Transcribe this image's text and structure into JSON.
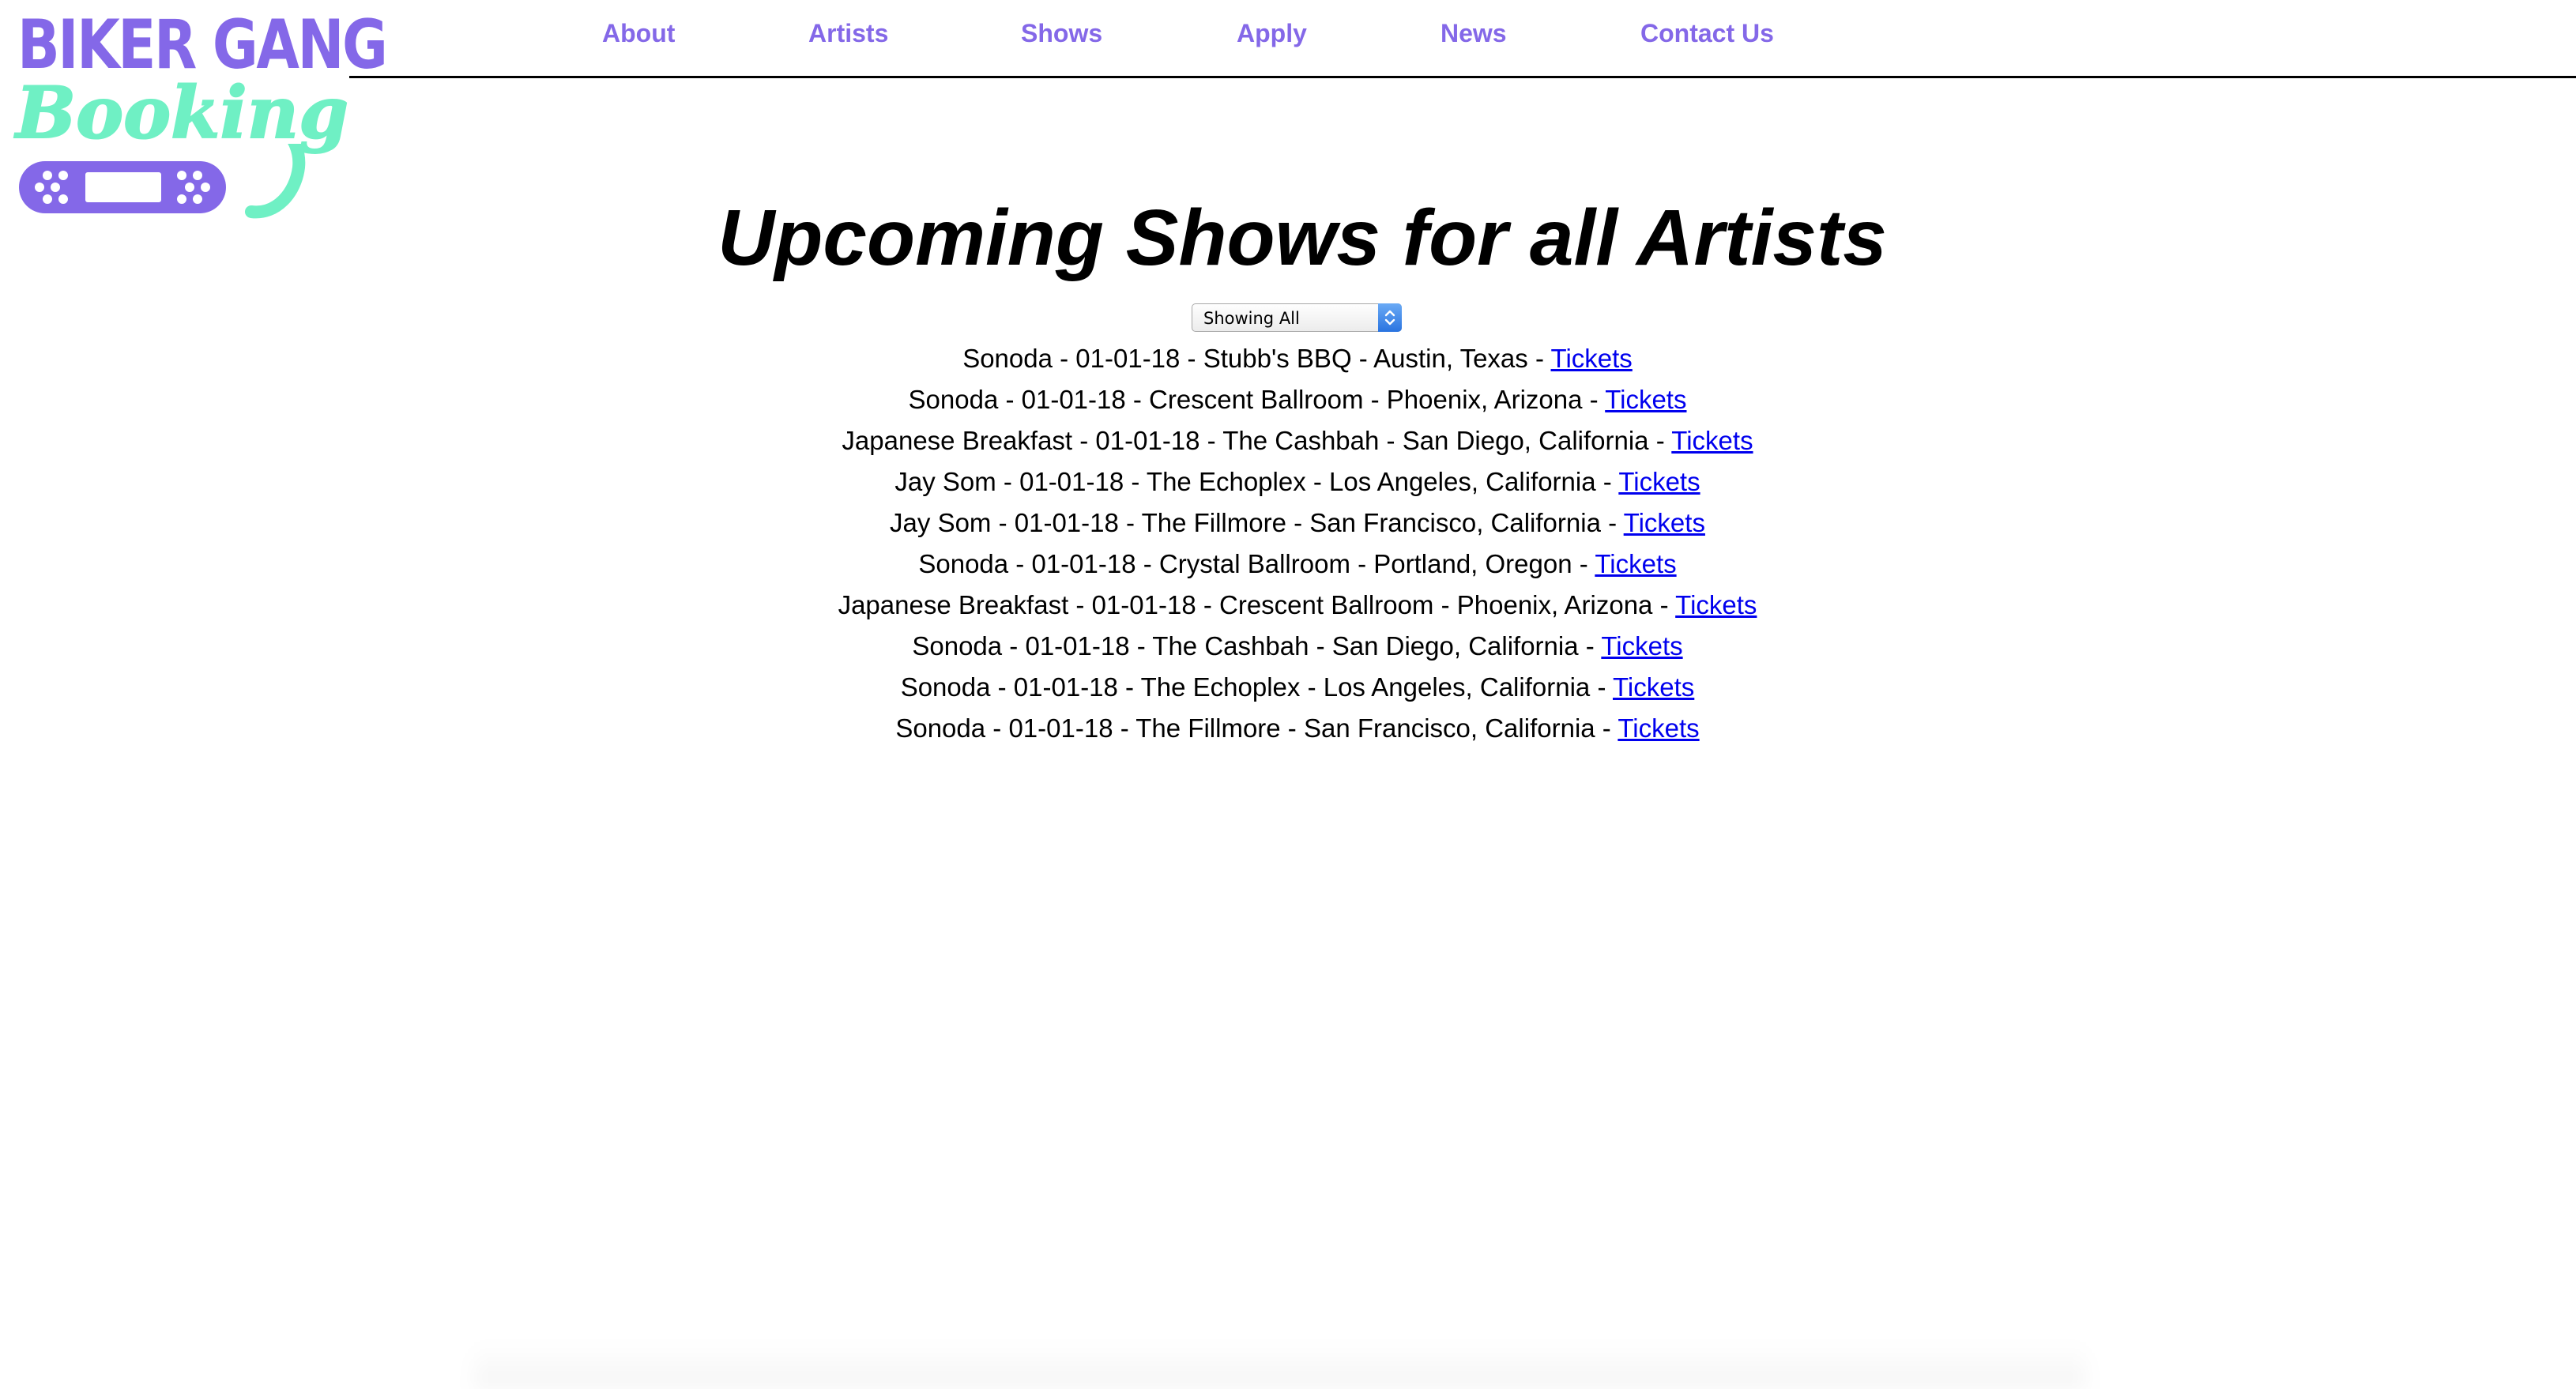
{
  "logo": {
    "line1": "BIKER GANG",
    "line2": "Booking",
    "colors": {
      "purple": "#8468e8",
      "mint": "#6ff0c4"
    }
  },
  "nav": {
    "items": [
      {
        "label": "About"
      },
      {
        "label": "Artists"
      },
      {
        "label": "Shows"
      },
      {
        "label": "Apply"
      },
      {
        "label": "News"
      },
      {
        "label": "Contact Us"
      }
    ],
    "color": "#8468e8"
  },
  "main": {
    "heading": "Upcoming Shows for all Artists",
    "filter": {
      "selected": "Showing All"
    },
    "shows": [
      {
        "text": "Sonoda - 01-01-18 - Stubb's BBQ - Austin, Texas - ",
        "link": "Tickets"
      },
      {
        "text": "Sonoda - 01-01-18 - Crescent Ballroom - Phoenix, Arizona - ",
        "link": "Tickets"
      },
      {
        "text": "Japanese Breakfast - 01-01-18 - The Cashbah - San Diego, California - ",
        "link": "Tickets"
      },
      {
        "text": "Jay Som - 01-01-18 - The Echoplex - Los Angeles, California - ",
        "link": "Tickets"
      },
      {
        "text": "Jay Som - 01-01-18 - The Fillmore - San Francisco, California - ",
        "link": "Tickets"
      },
      {
        "text": "Sonoda - 01-01-18 - Crystal Ballroom - Portland, Oregon - ",
        "link": "Tickets"
      },
      {
        "text": "Japanese Breakfast - 01-01-18 - Crescent Ballroom - Phoenix, Arizona - ",
        "link": "Tickets"
      },
      {
        "text": "Sonoda - 01-01-18 - The Cashbah - San Diego, California - ",
        "link": "Tickets"
      },
      {
        "text": "Sonoda - 01-01-18 - The Echoplex - Los Angeles, California - ",
        "link": "Tickets"
      },
      {
        "text": "Sonoda - 01-01-18 - The Fillmore - San Francisco, California - ",
        "link": "Tickets"
      }
    ],
    "link_color": "#0000ee"
  }
}
